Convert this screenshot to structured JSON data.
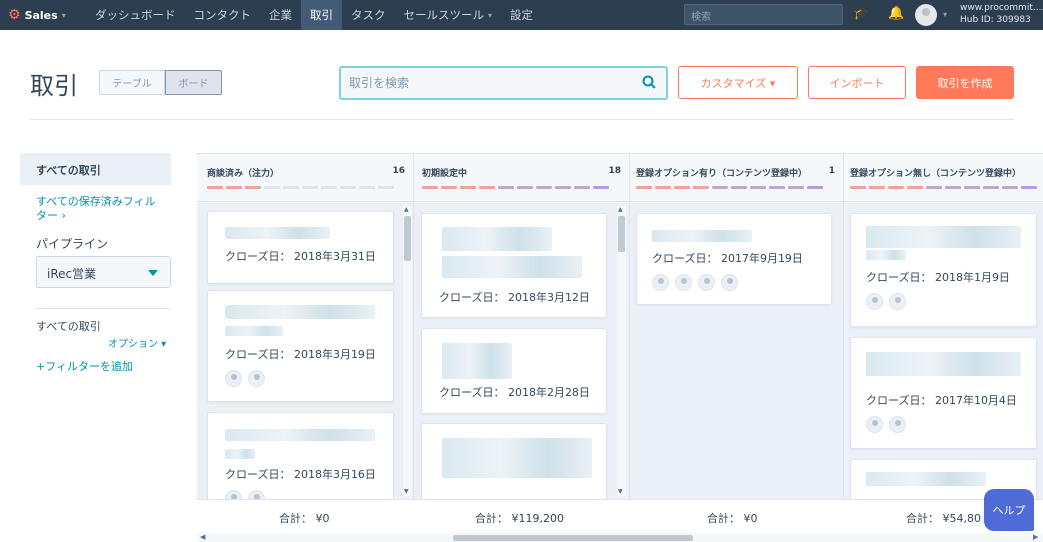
{
  "nav": {
    "brand": "Sales",
    "items": [
      {
        "label": "ダッシュボード",
        "caret": false
      },
      {
        "label": "コンタクト",
        "caret": false
      },
      {
        "label": "企業",
        "caret": false
      },
      {
        "label": "取引",
        "caret": false,
        "active": true
      },
      {
        "label": "タスク",
        "caret": false
      },
      {
        "label": "セールスツール",
        "caret": true
      },
      {
        "label": "設定",
        "caret": false
      }
    ],
    "search_placeholder": "検索",
    "account_line1": "www.procommit....",
    "account_line2": "Hub ID: 309983"
  },
  "header": {
    "title": "取引",
    "view_table": "テーブル",
    "view_board": "ボード",
    "search_placeholder": "取引を検索",
    "customize": "カスタマイズ ▾",
    "import": "インポート",
    "create": "取引を作成"
  },
  "sidebar": {
    "all_deals": "すべての取引",
    "saved_filters": "すべての保存済みフィルター ›",
    "pipeline_label": "パイプライン",
    "pipeline_value": "iRec営業",
    "all_deals_filter": "すべての取引",
    "options": "オプション ▾",
    "add_filter": "+フィルターを追加"
  },
  "board": {
    "columns": [
      {
        "title": "商談済み（注力）",
        "count": "16",
        "total": "合計： ¥0",
        "cards": [
          {
            "close": "クローズ日： 2018年3月31日"
          },
          {
            "close": "クローズ日： 2018年3月19日"
          },
          {
            "close": "クローズ日： 2018年3月16日"
          }
        ]
      },
      {
        "title": "初期設定中",
        "count": "18",
        "total": "合計： ¥119,200",
        "cards": [
          {
            "close": "クローズ日： 2018年3月12日"
          },
          {
            "close": "クローズ日： 2018年2月28日"
          }
        ]
      },
      {
        "title": "登録オプション有り（コンテンツ登録中）",
        "count": "1",
        "total": "合計： ¥0",
        "cards": [
          {
            "close": "クローズ日： 2017年9月19日"
          }
        ]
      },
      {
        "title": "登録オプション無し（コンテンツ登録中）",
        "count": "",
        "total": "合計： ¥54,80",
        "cards": [
          {
            "close": "クローズ日： 2018年1月9日"
          },
          {
            "close": "クローズ日： 2017年10月4日"
          }
        ]
      }
    ]
  },
  "help": "ヘルプ",
  "colors": {
    "nav_bg": "#2d3e50",
    "accent": "#ff7a59",
    "link": "#0091ae",
    "search_border": "#7fd1de",
    "help": "#4f6bd6"
  }
}
